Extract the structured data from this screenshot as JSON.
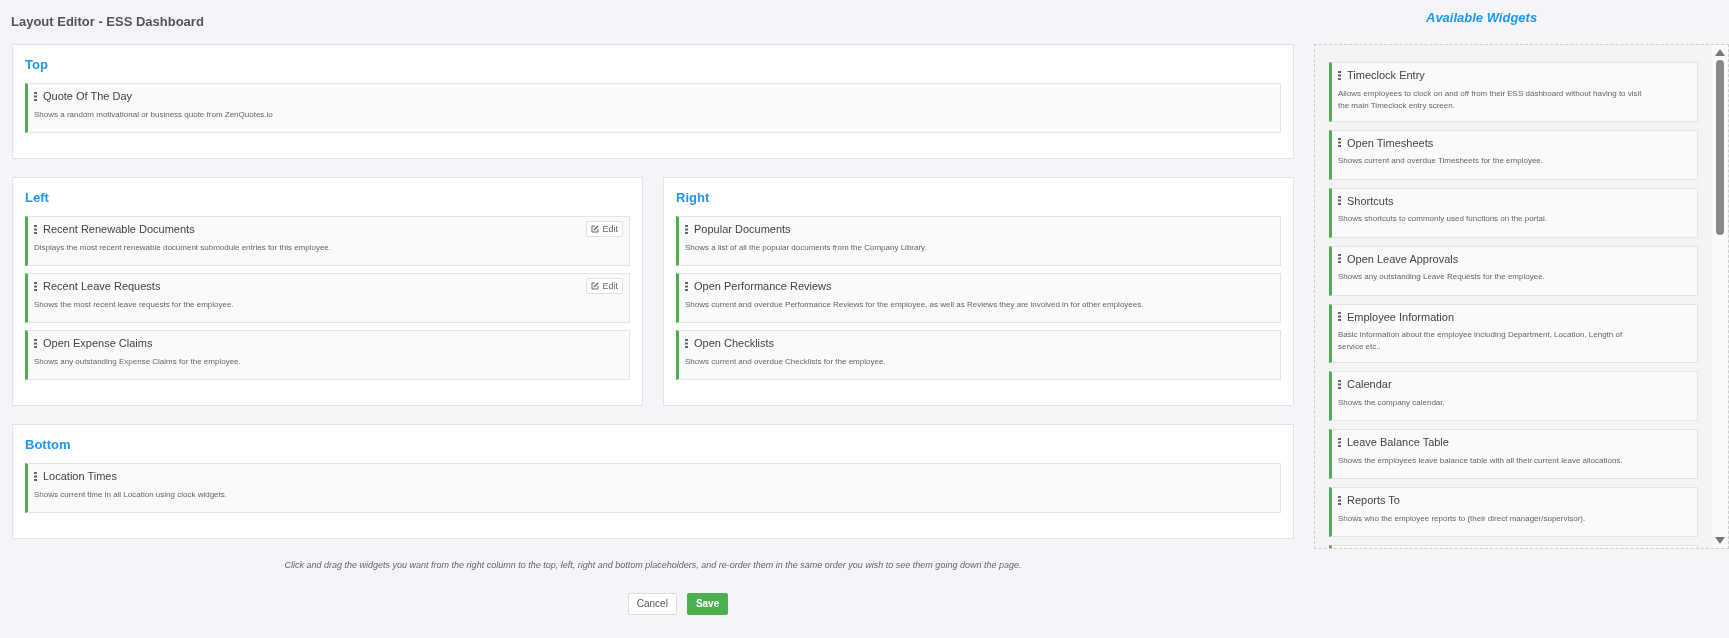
{
  "page_title": "Layout Editor - ESS Dashboard",
  "sections": [
    {
      "kind": "full",
      "title": "Top",
      "widgets": [
        {
          "title": "Quote Of The Day",
          "description": "Shows a random motivational or business quote from ZenQuotes.io"
        }
      ]
    },
    {
      "kind": "column",
      "title": "Left",
      "widgets": [
        {
          "title": "Recent Renewable Documents",
          "description": "Displays the most recent renewable document submodule entries for this employee.",
          "edit_button": "Edit"
        },
        {
          "title": "Recent Leave Requests",
          "description": "Shows the most recent leave requests for the employee.",
          "edit_button": "Edit"
        },
        {
          "title": "Open Expense Claims",
          "description": "Shows any outstanding Expense Claims for the employee."
        }
      ]
    },
    {
      "kind": "column",
      "title": "Right",
      "widgets": [
        {
          "title": "Popular Documents",
          "description": "Shows a list of all the popular documents from the Company Library."
        },
        {
          "title": "Open Performance Reviews",
          "description": "Shows current and overdue Performance Reviews for the employee, as well as Reviews they are involved in for other employees."
        },
        {
          "title": "Open Checklists",
          "description": "Shows current and overdue Checklists for the employee."
        }
      ]
    },
    {
      "kind": "full",
      "title": "Bottom",
      "widgets": [
        {
          "title": "Location Times",
          "description": "Shows current time in all Location using clock widgets."
        }
      ]
    }
  ],
  "help_text": "Click and drag the widgets you want from the right column to the top, left, right and bottom placeholders, and re-order them in the same order you wish to see them going down the page.",
  "buttons": [
    {
      "label": "Cancel",
      "kind": "secondary"
    },
    {
      "label": "Save",
      "kind": "primary"
    }
  ],
  "available_widgets": {
    "title": "Available Widgets",
    "items": [
      {
        "title": "Timeclock Entry",
        "description": "Allows employees to clock on and off from their ESS dashboard without having to visit the main Timeclock entry screen."
      },
      {
        "title": "Open Timesheets",
        "description": "Shows current and overdue Timesheets for the employee."
      },
      {
        "title": "Shortcuts",
        "description": "Shows shortcuts to commonly used functions on the portal."
      },
      {
        "title": "Open Leave Approvals",
        "description": "Shows any outstanding Leave Requests for the employee."
      },
      {
        "title": "Employee Information",
        "description": "Basic information about the employee including Department, Location, Length of service etc.."
      },
      {
        "title": "Calendar",
        "description": "Shows the company calendar."
      },
      {
        "title": "Leave Balance Table",
        "description": "Shows the employees leave balance table with all their current leave allocations."
      },
      {
        "title": "Reports To",
        "description": "Shows who the employee reports to (their direct manager/supervisor)."
      }
    ]
  }
}
